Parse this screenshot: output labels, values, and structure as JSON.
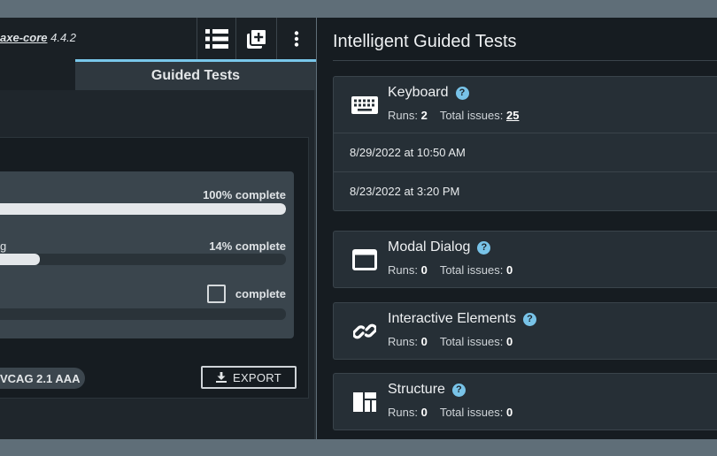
{
  "toolbar": {
    "library_name": "axe-core",
    "library_version": "4.4.2"
  },
  "tabs": {
    "active_label": "Guided Tests"
  },
  "progress": [
    {
      "label": "",
      "percent": 100,
      "text": "100% complete"
    },
    {
      "label": "g",
      "percent": 14,
      "text": "14% complete"
    },
    {
      "label": "",
      "percent": 0,
      "text": "complete",
      "checkbox": true
    }
  ],
  "footer": {
    "standard": "VCAG 2.1 AAA",
    "export_label": "EXPORT"
  },
  "right": {
    "title": "Intelligent Guided Tests",
    "cards": [
      {
        "name": "Keyboard",
        "icon": "keyboard-icon",
        "runs_label": "Runs:",
        "runs": "2",
        "issues_label": "Total issues:",
        "issues": "25",
        "run_dates": [
          "8/29/2022 at 10:50 AM",
          "8/23/2022 at 3:20 PM"
        ]
      },
      {
        "name": "Modal Dialog",
        "icon": "modal-dialog-icon",
        "runs_label": "Runs:",
        "runs": "0",
        "issues_label": "Total issues:",
        "issues": "0"
      },
      {
        "name": "Interactive Elements",
        "icon": "link-icon",
        "runs_label": "Runs:",
        "runs": "0",
        "issues_label": "Total issues:",
        "issues": "0"
      },
      {
        "name": "Structure",
        "icon": "structure-icon",
        "runs_label": "Runs:",
        "runs": "0",
        "issues_label": "Total issues:",
        "issues": "0"
      }
    ]
  },
  "colors": {
    "accent": "#79c7ea",
    "help_icon": "#78c3e8",
    "panel_bg": "#161c21",
    "card_bg": "#262f36"
  }
}
